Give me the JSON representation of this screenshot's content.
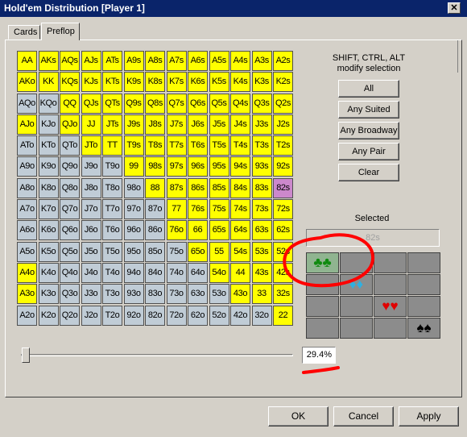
{
  "window": {
    "title": "Hold'em Distribution [Player 1]",
    "close_glyph": "✕"
  },
  "tabs": [
    {
      "label": "Cards"
    },
    {
      "label": "Preflop"
    }
  ],
  "hint": {
    "line1": "SHIFT, CTRL, ALT",
    "line2": "modify selection"
  },
  "buttons": {
    "all": "All",
    "any_suited": "Any Suited",
    "any_broadway": "Any Broadway",
    "any_pair": "Any Pair",
    "clear": "Clear"
  },
  "selected": {
    "label": "Selected",
    "value": "82s"
  },
  "slider": {
    "percent_text": "29.4%",
    "value": 0.0
  },
  "footer": {
    "ok": "OK",
    "cancel": "Cancel",
    "apply": "Apply"
  },
  "annotation_color": "#ff0000",
  "colors": {
    "selected": "#ffff00",
    "unselected": "#c0ccd6",
    "highlight": "#cc88cc"
  },
  "suits": {
    "icons": [
      "clubs-icon",
      "diamonds-icon",
      "hearts-icon",
      "spades-icon"
    ],
    "rows": [
      [
        {
          "glyph": "♣♣",
          "style": "green",
          "name": "clubs-clubs"
        },
        {
          "glyph": "",
          "style": "gray",
          "name": "clubs-diamonds"
        },
        {
          "glyph": "",
          "style": "gray",
          "name": "clubs-hearts"
        },
        {
          "glyph": "",
          "style": "gray",
          "name": "clubs-spades"
        }
      ],
      [
        {
          "glyph": "",
          "style": "gray",
          "name": "diamonds-clubs"
        },
        {
          "glyph": "♦♦",
          "style": "gray cyan",
          "name": "diamonds-diamonds"
        },
        {
          "glyph": "",
          "style": "gray",
          "name": "diamonds-hearts"
        },
        {
          "glyph": "",
          "style": "gray",
          "name": "diamonds-spades"
        }
      ],
      [
        {
          "glyph": "",
          "style": "gray",
          "name": "hearts-clubs"
        },
        {
          "glyph": "",
          "style": "gray",
          "name": "hearts-diamonds"
        },
        {
          "glyph": "♥♥",
          "style": "gray red",
          "name": "hearts-hearts"
        },
        {
          "glyph": "",
          "style": "gray",
          "name": "hearts-spades"
        }
      ],
      [
        {
          "glyph": "",
          "style": "gray",
          "name": "spades-clubs"
        },
        {
          "glyph": "",
          "style": "gray",
          "name": "spades-diamonds"
        },
        {
          "glyph": "",
          "style": "gray",
          "name": "spades-hearts"
        },
        {
          "glyph": "♠♠",
          "style": "gray black",
          "name": "spades-spades"
        }
      ]
    ]
  },
  "hands": [
    [
      [
        "AA",
        "s"
      ],
      [
        "AKs",
        "s"
      ],
      [
        "AQs",
        "s"
      ],
      [
        "AJs",
        "s"
      ],
      [
        "ATs",
        "s"
      ],
      [
        "A9s",
        "s"
      ],
      [
        "A8s",
        "s"
      ],
      [
        "A7s",
        "s"
      ],
      [
        "A6s",
        "s"
      ],
      [
        "A5s",
        "s"
      ],
      [
        "A4s",
        "s"
      ],
      [
        "A3s",
        "s"
      ],
      [
        "A2s",
        "s"
      ]
    ],
    [
      [
        "AKo",
        "s"
      ],
      [
        "KK",
        "s"
      ],
      [
        "KQs",
        "s"
      ],
      [
        "KJs",
        "s"
      ],
      [
        "KTs",
        "s"
      ],
      [
        "K9s",
        "s"
      ],
      [
        "K8s",
        "s"
      ],
      [
        "K7s",
        "s"
      ],
      [
        "K6s",
        "s"
      ],
      [
        "K5s",
        "s"
      ],
      [
        "K4s",
        "s"
      ],
      [
        "K3s",
        "s"
      ],
      [
        "K2s",
        "s"
      ]
    ],
    [
      [
        "AQo",
        "u"
      ],
      [
        "KQo",
        "u"
      ],
      [
        "QQ",
        "s"
      ],
      [
        "QJs",
        "s"
      ],
      [
        "QTs",
        "s"
      ],
      [
        "Q9s",
        "s"
      ],
      [
        "Q8s",
        "s"
      ],
      [
        "Q7s",
        "s"
      ],
      [
        "Q6s",
        "s"
      ],
      [
        "Q5s",
        "s"
      ],
      [
        "Q4s",
        "s"
      ],
      [
        "Q3s",
        "s"
      ],
      [
        "Q2s",
        "s"
      ]
    ],
    [
      [
        "AJo",
        "s"
      ],
      [
        "KJo",
        "u"
      ],
      [
        "QJo",
        "s"
      ],
      [
        "JJ",
        "s"
      ],
      [
        "JTs",
        "s"
      ],
      [
        "J9s",
        "s"
      ],
      [
        "J8s",
        "s"
      ],
      [
        "J7s",
        "s"
      ],
      [
        "J6s",
        "s"
      ],
      [
        "J5s",
        "s"
      ],
      [
        "J4s",
        "s"
      ],
      [
        "J3s",
        "s"
      ],
      [
        "J2s",
        "s"
      ]
    ],
    [
      [
        "ATo",
        "u"
      ],
      [
        "KTo",
        "u"
      ],
      [
        "QTo",
        "u"
      ],
      [
        "JTo",
        "s"
      ],
      [
        "TT",
        "s"
      ],
      [
        "T9s",
        "s"
      ],
      [
        "T8s",
        "s"
      ],
      [
        "T7s",
        "s"
      ],
      [
        "T6s",
        "s"
      ],
      [
        "T5s",
        "s"
      ],
      [
        "T4s",
        "s"
      ],
      [
        "T3s",
        "s"
      ],
      [
        "T2s",
        "s"
      ]
    ],
    [
      [
        "A9o",
        "u"
      ],
      [
        "K9o",
        "u"
      ],
      [
        "Q9o",
        "u"
      ],
      [
        "J9o",
        "u"
      ],
      [
        "T9o",
        "u"
      ],
      [
        "99",
        "s"
      ],
      [
        "98s",
        "s"
      ],
      [
        "97s",
        "s"
      ],
      [
        "96s",
        "s"
      ],
      [
        "95s",
        "s"
      ],
      [
        "94s",
        "s"
      ],
      [
        "93s",
        "s"
      ],
      [
        "92s",
        "s"
      ]
    ],
    [
      [
        "A8o",
        "u"
      ],
      [
        "K8o",
        "u"
      ],
      [
        "Q8o",
        "u"
      ],
      [
        "J8o",
        "u"
      ],
      [
        "T8o",
        "u"
      ],
      [
        "98o",
        "u"
      ],
      [
        "88",
        "s"
      ],
      [
        "87s",
        "s"
      ],
      [
        "86s",
        "s"
      ],
      [
        "85s",
        "s"
      ],
      [
        "84s",
        "s"
      ],
      [
        "83s",
        "s"
      ],
      [
        "82s",
        "h"
      ]
    ],
    [
      [
        "A7o",
        "u"
      ],
      [
        "K7o",
        "u"
      ],
      [
        "Q7o",
        "u"
      ],
      [
        "J7o",
        "u"
      ],
      [
        "T7o",
        "u"
      ],
      [
        "97o",
        "u"
      ],
      [
        "87o",
        "u"
      ],
      [
        "77",
        "s"
      ],
      [
        "76s",
        "s"
      ],
      [
        "75s",
        "s"
      ],
      [
        "74s",
        "s"
      ],
      [
        "73s",
        "s"
      ],
      [
        "72s",
        "s"
      ]
    ],
    [
      [
        "A6o",
        "u"
      ],
      [
        "K6o",
        "u"
      ],
      [
        "Q6o",
        "u"
      ],
      [
        "J6o",
        "u"
      ],
      [
        "T6o",
        "u"
      ],
      [
        "96o",
        "u"
      ],
      [
        "86o",
        "u"
      ],
      [
        "76o",
        "s"
      ],
      [
        "66",
        "s"
      ],
      [
        "65s",
        "s"
      ],
      [
        "64s",
        "s"
      ],
      [
        "63s",
        "s"
      ],
      [
        "62s",
        "s"
      ]
    ],
    [
      [
        "A5o",
        "u"
      ],
      [
        "K5o",
        "u"
      ],
      [
        "Q5o",
        "u"
      ],
      [
        "J5o",
        "u"
      ],
      [
        "T5o",
        "u"
      ],
      [
        "95o",
        "u"
      ],
      [
        "85o",
        "u"
      ],
      [
        "75o",
        "u"
      ],
      [
        "65o",
        "s"
      ],
      [
        "55",
        "s"
      ],
      [
        "54s",
        "s"
      ],
      [
        "53s",
        "s"
      ],
      [
        "52s",
        "s"
      ]
    ],
    [
      [
        "A4o",
        "s"
      ],
      [
        "K4o",
        "u"
      ],
      [
        "Q4o",
        "u"
      ],
      [
        "J4o",
        "u"
      ],
      [
        "T4o",
        "u"
      ],
      [
        "94o",
        "u"
      ],
      [
        "84o",
        "u"
      ],
      [
        "74o",
        "u"
      ],
      [
        "64o",
        "u"
      ],
      [
        "54o",
        "s"
      ],
      [
        "44",
        "s"
      ],
      [
        "43s",
        "s"
      ],
      [
        "42s",
        "s"
      ]
    ],
    [
      [
        "A3o",
        "s"
      ],
      [
        "K3o",
        "u"
      ],
      [
        "Q3o",
        "u"
      ],
      [
        "J3o",
        "u"
      ],
      [
        "T3o",
        "u"
      ],
      [
        "93o",
        "u"
      ],
      [
        "83o",
        "u"
      ],
      [
        "73o",
        "u"
      ],
      [
        "63o",
        "u"
      ],
      [
        "53o",
        "u"
      ],
      [
        "43o",
        "s"
      ],
      [
        "33",
        "s"
      ],
      [
        "32s",
        "s"
      ]
    ],
    [
      [
        "A2o",
        "u"
      ],
      [
        "K2o",
        "u"
      ],
      [
        "Q2o",
        "u"
      ],
      [
        "J2o",
        "u"
      ],
      [
        "T2o",
        "u"
      ],
      [
        "92o",
        "u"
      ],
      [
        "82o",
        "u"
      ],
      [
        "72o",
        "u"
      ],
      [
        "62o",
        "u"
      ],
      [
        "52o",
        "u"
      ],
      [
        "42o",
        "u"
      ],
      [
        "32o",
        "u"
      ],
      [
        "22",
        "s"
      ]
    ]
  ]
}
